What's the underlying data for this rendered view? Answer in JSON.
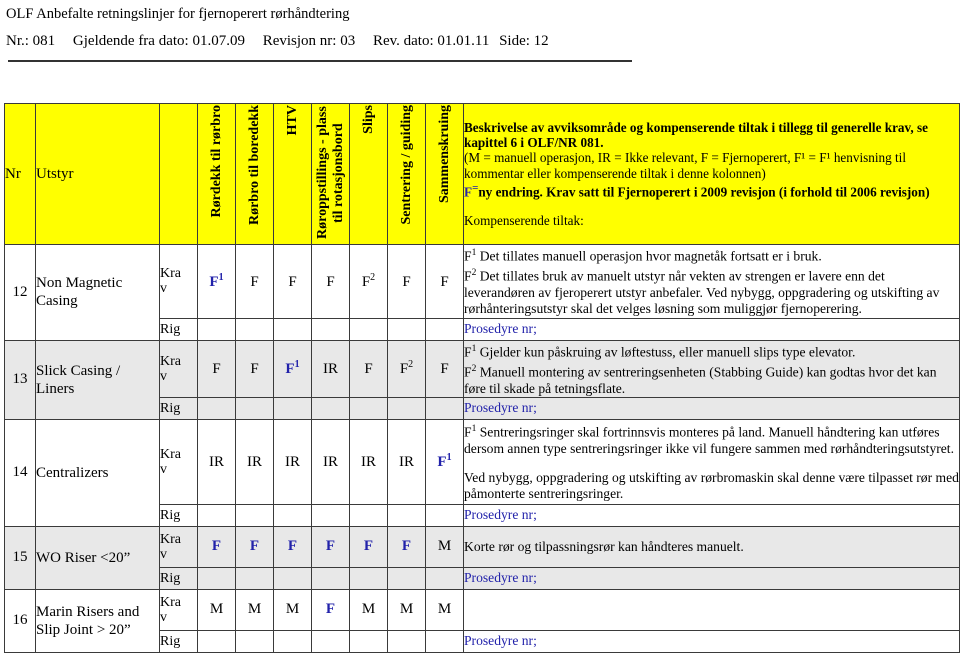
{
  "document": {
    "title": "OLF Anbefalte retningslinjer for fjernoperert rørhåndtering",
    "meta": {
      "nr": "Nr.: 081",
      "valid_from": "Gjeldende fra dato: 01.07.09",
      "revision": "Revisjon nr: 03",
      "rev_date": "Rev. dato: 01.01.11",
      "page": "Side: 12"
    }
  },
  "table": {
    "headers": {
      "nr": "Nr",
      "utstyr": "Utstyr",
      "krav_rig_blank": "",
      "columns": [
        "Rørdekk til rørbro",
        "Rørbro til boredekk",
        "HTV",
        "Røroppstillings - plass til rotasjonsbord",
        "Slips",
        "Sentrering / guiding",
        "Sammenskruing"
      ],
      "description": {
        "line1": "Beskrivelse av avviksområde og kompenserende tiltak i tillegg til generelle krav, se kapittel 6 i OLF/NR 081.",
        "line2": "(M = manuell operasjon, IR = Ikke relevant, F = Fjernoperert, F¹ = F¹ henvisning til kommentar eller kompenserende tiltak i denne kolonnen)",
        "line3_prefix": "F",
        "line3_eq": "=",
        "line3": "ny endring. Krav satt til Fjernoperert i 2009 revisjon (i forhold til 2006 revisjon)",
        "line4": "Kompenserende tiltak:"
      }
    },
    "row_labels": {
      "krav": "Kra v",
      "krav_l1": "Kra",
      "krav_l2": "v",
      "rig": "Rig",
      "prosedyre": "Prosedyre nr;"
    },
    "rows": [
      {
        "nr": "12",
        "utstyr": "Non Magnetic Casing",
        "shaded": false,
        "values": [
          {
            "text": "F",
            "sup": "1",
            "blue": true
          },
          {
            "text": "F",
            "sup": "",
            "blue": false
          },
          {
            "text": "F",
            "sup": "",
            "blue": false
          },
          {
            "text": "F",
            "sup": "",
            "blue": false
          },
          {
            "text": "F",
            "sup": "2",
            "blue": false
          },
          {
            "text": "F",
            "sup": "",
            "blue": false
          },
          {
            "text": "F",
            "sup": "",
            "blue": false
          }
        ],
        "description": [
          {
            "sup": "1",
            "text": "Det tillates manuell operasjon hvor magnetåk fortsatt er i bruk."
          },
          {
            "sup": "2",
            "text": "Det tillates bruk av manuelt utstyr når vekten av strengen er lavere enn det leverandøren av fjeroperert utstyr anbefaler. Ved nybygg, oppgradering og utskifting av rørhånteringsutstyr skal det velges løsning som muliggjør fjernoperering."
          }
        ]
      },
      {
        "nr": "13",
        "utstyr": "Slick Casing / Liners",
        "shaded": true,
        "values": [
          {
            "text": "F",
            "sup": "",
            "blue": false
          },
          {
            "text": "F",
            "sup": "",
            "blue": false
          },
          {
            "text": "F",
            "sup": "1",
            "blue": true
          },
          {
            "text": "IR",
            "sup": "",
            "blue": false
          },
          {
            "text": "F",
            "sup": "",
            "blue": false
          },
          {
            "text": "F",
            "sup": "2",
            "blue": false
          },
          {
            "text": "F",
            "sup": "",
            "blue": false
          }
        ],
        "description": [
          {
            "sup": "1",
            "text": "Gjelder kun påskruing av løftestuss, eller manuell slips type elevator."
          },
          {
            "sup": "2",
            "text": "Manuell montering av sentreringsenheten (Stabbing Guide) kan godtas hvor det kan føre til skade på tetningsflate."
          }
        ]
      },
      {
        "nr": "14",
        "utstyr": "Centralizers",
        "shaded": false,
        "values": [
          {
            "text": "IR",
            "sup": "",
            "blue": false
          },
          {
            "text": "IR",
            "sup": "",
            "blue": false
          },
          {
            "text": "IR",
            "sup": "",
            "blue": false
          },
          {
            "text": "IR",
            "sup": "",
            "blue": false
          },
          {
            "text": "IR",
            "sup": "",
            "blue": false
          },
          {
            "text": "IR",
            "sup": "",
            "blue": false
          },
          {
            "text": "F",
            "sup": "1",
            "blue": true
          }
        ],
        "description": [
          {
            "sup": "1",
            "text": "Sentreringsringer skal fortrinnsvis monteres på land. Manuell håndtering kan utføres dersom annen type sentreringsringer ikke vil fungere sammen med rørhåndteringsutstyret."
          },
          {
            "sup": "",
            "text": "Ved nybygg, oppgradering og utskifting av rørbromaskin skal denne være tilpasset rør med påmonterte sentreringsringer."
          }
        ]
      },
      {
        "nr": "15",
        "utstyr": "WO Riser <20”",
        "shaded": true,
        "values": [
          {
            "text": "F",
            "sup": "",
            "blue": true
          },
          {
            "text": "F",
            "sup": "",
            "blue": true
          },
          {
            "text": "F",
            "sup": "",
            "blue": true
          },
          {
            "text": "F",
            "sup": "",
            "blue": true
          },
          {
            "text": "F",
            "sup": "",
            "blue": true
          },
          {
            "text": "F",
            "sup": "",
            "blue": true
          },
          {
            "text": "M",
            "sup": "",
            "blue": false
          }
        ],
        "description": [
          {
            "sup": "",
            "text": "Korte rør og tilpassningsrør kan håndteres manuelt."
          }
        ]
      },
      {
        "nr": "16",
        "utstyr": "Marin Risers and Slip Joint > 20”",
        "shaded": false,
        "values": [
          {
            "text": "M",
            "sup": "",
            "blue": false
          },
          {
            "text": "M",
            "sup": "",
            "blue": false
          },
          {
            "text": "M",
            "sup": "",
            "blue": false
          },
          {
            "text": "F",
            "sup": "",
            "blue": true
          },
          {
            "text": "M",
            "sup": "",
            "blue": false
          },
          {
            "text": "M",
            "sup": "",
            "blue": false
          },
          {
            "text": "M",
            "sup": "",
            "blue": false
          }
        ],
        "description": []
      }
    ]
  },
  "colors": {
    "header_bg": "#FFFF00",
    "shaded_row": "#E8E8E8",
    "accent_blue": "#2222AA",
    "border": "#3A3A3A"
  }
}
